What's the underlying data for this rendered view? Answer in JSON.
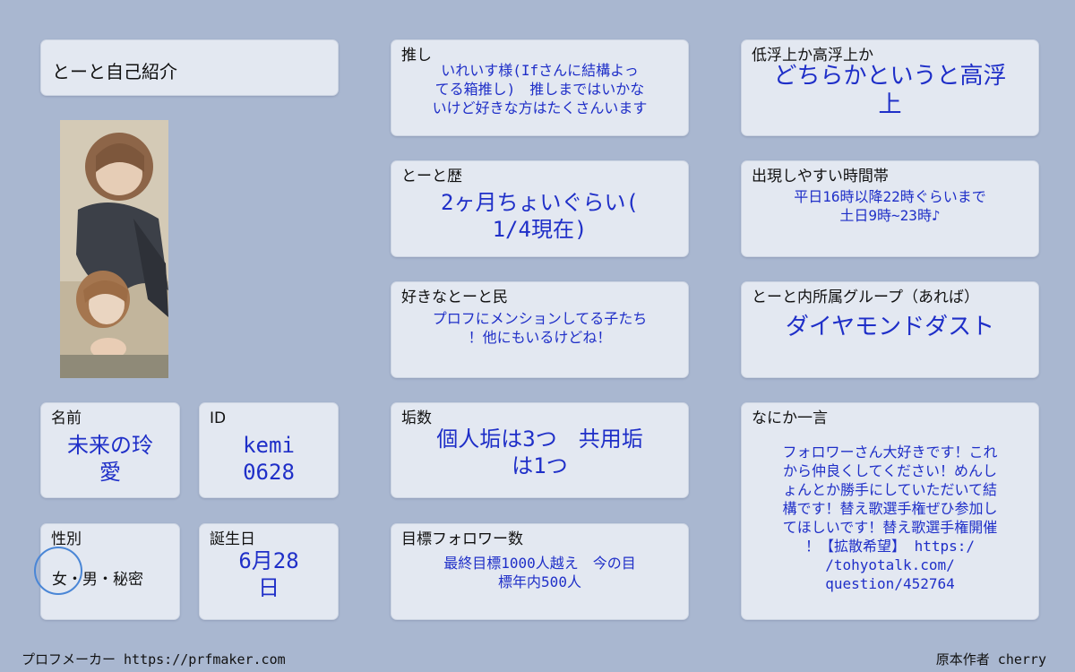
{
  "profile_title": "とーと自己紹介",
  "name": {
    "label": "名前",
    "value": "未来の玲\n愛"
  },
  "id": {
    "label": "ID",
    "value": "kemi\n0628"
  },
  "gender": {
    "label": "性別",
    "options": "女・男・秘密",
    "selected": "女"
  },
  "birthday": {
    "label": "誕生日",
    "value": "6月28\n日"
  },
  "oshi": {
    "label": "推し",
    "value": "いれいす様(Ifさんに結構よっ\nてる箱推し)　推しまではいかな\nいけど好きな方はたくさんいます"
  },
  "toto_history": {
    "label": "とーと歴",
    "value": "2ヶ月ちょいぐらい(\n1/4現在)"
  },
  "favorite_users": {
    "label": "好きなとーと民",
    "value": "プロフにメンションしてる子たち\n！他にもいるけどね！"
  },
  "account_count": {
    "label": "垢数",
    "value": "個人垢は3つ　共用垢\nは1つ"
  },
  "follower_goal": {
    "label": "目標フォロワー数",
    "value": "最終目標1000人越え　今の目\n標年内500人"
  },
  "activity": {
    "label": "低浮上か高浮上か",
    "value": "どちらかというと高浮\n上"
  },
  "active_time": {
    "label": "出現しやすい時間帯",
    "value": "平日16時以降22時ぐらいまで\n土日9時~23時♪"
  },
  "group": {
    "label": "とーと内所属グループ（あれば）",
    "value": "ダイヤモンドダスト"
  },
  "message": {
    "label": "なにか一言",
    "value": "フォロワーさん大好きです！これ\nから仲良くしてください！めんし\nょんとか勝手にしていただいて結\n構です！替え歌選手権ぜひ参加し\nてほしいです！替え歌選手権開催\n！【拡散希望】 https:/\n/tohyotalk.com/\nquestion/452764"
  },
  "footer": {
    "maker": "プロフメーカー https://prfmaker.com",
    "author": "原本作者 cherry"
  },
  "colors": {
    "background": "#a9b7d0",
    "card": "#e3e8f1",
    "value_text": "#1f2fc8",
    "selection_ring": "#4a86d6"
  }
}
